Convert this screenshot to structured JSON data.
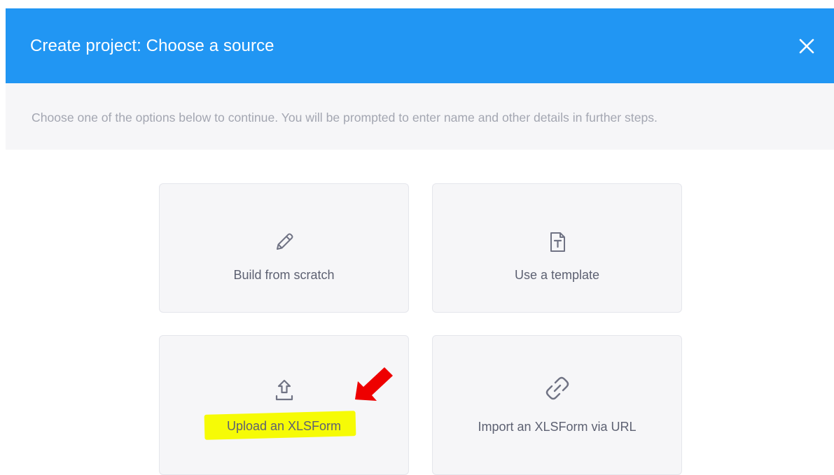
{
  "modal": {
    "title": "Create project: Choose a source",
    "close_icon": "close-icon",
    "instructions": "Choose one of the options below to continue. You will be prompted to enter name and other details in further steps."
  },
  "options": [
    {
      "label": "Build from scratch",
      "icon": "pencil-icon"
    },
    {
      "label": "Use a template",
      "icon": "template-file-icon"
    },
    {
      "label": "Upload an XLSForm",
      "icon": "upload-icon"
    },
    {
      "label": "Import an XLSForm via URL",
      "icon": "link-icon"
    }
  ],
  "annotations": {
    "highlight_color": "#f6fb06",
    "arrow_color": "#ee0000"
  },
  "colors": {
    "header": "#2196f3",
    "subheader_bg": "#f6f6f8",
    "card_bg": "#f6f6f8",
    "card_text": "#5d6172",
    "muted_text": "#a3a6b1"
  }
}
